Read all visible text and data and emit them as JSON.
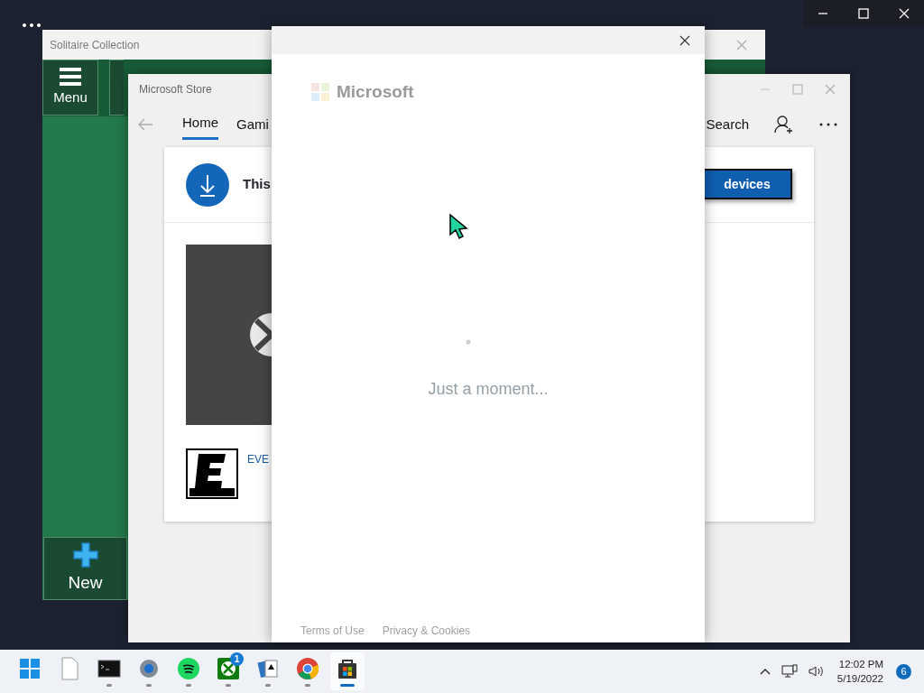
{
  "solitaire_window": {
    "title": "Solitaire Collection",
    "menu_button": {
      "label": "Menu"
    },
    "new_button": {
      "label": "New"
    }
  },
  "store_window": {
    "title": "Microsoft Store",
    "tabs": [
      {
        "label": "Home",
        "selected": true
      },
      {
        "label": "Gami",
        "selected": false
      }
    ],
    "search_label": "Search",
    "banner": {
      "text": "This",
      "button": "devices"
    },
    "rating_text": "EVE"
  },
  "sign_in_dialog": {
    "brand": "Microsoft",
    "status": "Just a moment...",
    "links": [
      "Terms of Use",
      "Privacy & Cookies"
    ]
  },
  "taskbar": {
    "apps": [
      {
        "kind": "start",
        "running": false,
        "active": false
      },
      {
        "kind": "file",
        "running": false,
        "active": false
      },
      {
        "kind": "terminal",
        "running": true,
        "active": false
      },
      {
        "kind": "settings",
        "running": true,
        "active": false
      },
      {
        "kind": "spotify",
        "running": true,
        "active": false
      },
      {
        "kind": "xbox",
        "running": true,
        "active": false,
        "badge": "1"
      },
      {
        "kind": "solitaire",
        "running": true,
        "active": false
      },
      {
        "kind": "chrome",
        "running": true,
        "active": false
      },
      {
        "kind": "store",
        "running": true,
        "active": true
      }
    ],
    "clock": {
      "time": "12:02 PM",
      "date": "5/19/2022"
    },
    "notifications": "6"
  }
}
